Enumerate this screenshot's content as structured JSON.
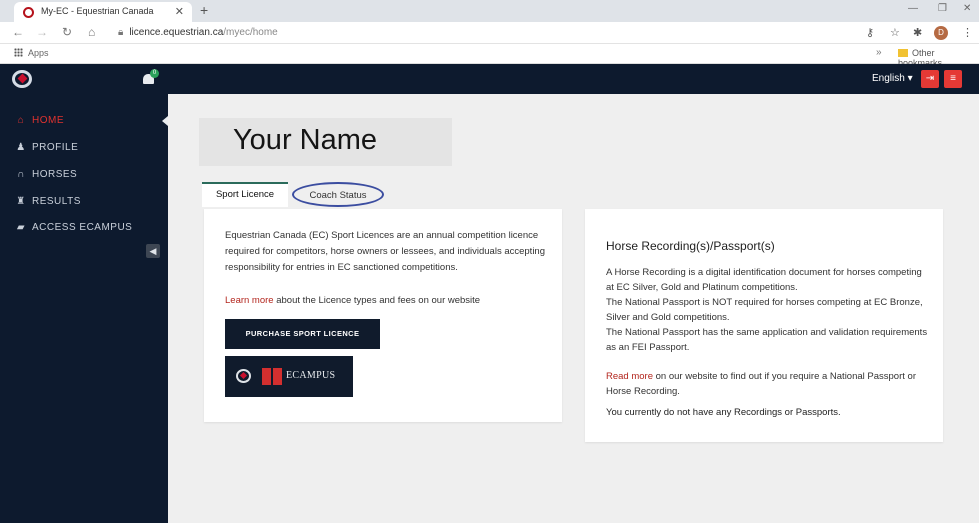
{
  "browser": {
    "tab_title": "My-EC - Equestrian Canada",
    "url_domain": "licence.equestrian.ca",
    "url_path": "/myec/home",
    "apps_label": "Apps",
    "other_bookmarks": "Other bookmarks",
    "profile_initial": "D"
  },
  "header": {
    "notification_count": "0",
    "language": "English ▾"
  },
  "sidebar": {
    "items": [
      {
        "label": "HOME",
        "icon": "home-icon",
        "glyph": "⌂"
      },
      {
        "label": "PROFILE",
        "icon": "user-icon",
        "glyph": "♟"
      },
      {
        "label": "HORSES",
        "icon": "horseshoe-icon",
        "glyph": "∩"
      },
      {
        "label": "RESULTS",
        "icon": "trophy-icon",
        "glyph": "♜"
      },
      {
        "label": "ACCESS ECAMPUS",
        "icon": "book-icon",
        "glyph": "▰"
      }
    ]
  },
  "main": {
    "name": "Your Name",
    "tabs": [
      {
        "label": "Sport Licence"
      },
      {
        "label": "Coach Status"
      }
    ],
    "licence_card": {
      "description": "Equestrian Canada (EC) Sport Licences are an annual competition licence required for competitors, horse owners or lessees, and individuals accepting responsibility for entries in EC sanctioned competitions.",
      "learn_more_link": "Learn more",
      "learn_more_rest": " about the Licence types and fees on our website",
      "purchase_button": "PURCHASE SPORT LICENCE",
      "ecampus_label": "ECAMPUS"
    },
    "passport_card": {
      "title": "Horse Recording(s)/Passport(s)",
      "para1": "A Horse Recording is a digital identification document for horses competing at EC Silver, Gold and Platinum competitions.",
      "para2": "The National Passport is NOT required for horses competing at EC Bronze, Silver and Gold competitions.",
      "para3": "The National Passport has the same application and validation requirements as an FEI Passport.",
      "read_more_link": "Read more",
      "read_more_rest": " on our website to find out if you require a National Passport or Horse Recording.",
      "status": "You currently do not have any Recordings or Passports."
    }
  },
  "colors": {
    "nav_dark": "#0d1a2e",
    "accent_red": "#e0332f",
    "link_red": "#b3261e",
    "tab_green": "#2b6b5b",
    "circle_blue": "#3b4da0"
  }
}
